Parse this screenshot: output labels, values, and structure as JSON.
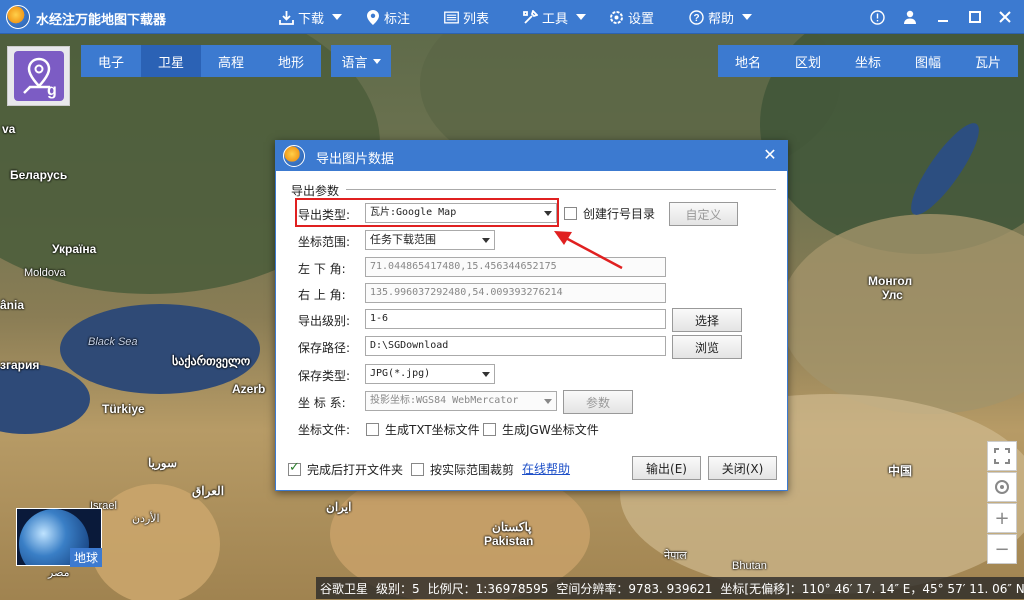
{
  "app": {
    "title": "水经注万能地图下载器"
  },
  "menu": {
    "download": "下载",
    "mark": "标注",
    "list": "列表",
    "tools": "工具",
    "settings": "设置",
    "help": "帮助"
  },
  "toolbar_left": {
    "electronic": "电子",
    "satellite": "卫星",
    "elevation": "高程",
    "terrain": "地形",
    "language": "语言"
  },
  "toolbar_right": {
    "placename": "地名",
    "district": "区划",
    "coordinate": "坐标",
    "sheet": "图幅",
    "tile": "瓦片"
  },
  "map_labels": {
    "belarus": "Беларусь",
    "ukraine": "Україна",
    "moldova": "Moldova",
    "romania": "ânia",
    "black_sea": "Black Sea",
    "georgia": "საქართველო",
    "bulgaria": "згария",
    "azerb": "Azerb",
    "turkiye": "Türkiye",
    "syria": "سوريا",
    "iraq": "العراق",
    "iran": "ایران",
    "israel": "Israel",
    "jordan": "الأردن",
    "egypt": "مصر",
    "pakistan_ur": "پاکستان",
    "pakistan": "Pakistan",
    "nepal": "नेपाल",
    "bhutan": "Bhutan",
    "mongolia1": "Монгол",
    "mongolia2": "Улс",
    "china": "中国",
    "va": "va"
  },
  "dialog": {
    "title": "导出图片数据",
    "close": "✕",
    "group": "导出参数",
    "export_type_label": "导出类型:",
    "export_type_value": "瓦片:Google Map",
    "create_dir_label": "创建行号目录",
    "custom_btn": "自定义",
    "coord_range_label": "坐标范围:",
    "coord_range_value": "任务下载范围",
    "lower_left_label": "左 下 角:",
    "lower_left_value": "71.044865417480,15.456344652175",
    "upper_right_label": "右 上 角:",
    "upper_right_value": "135.996037292480,54.009393276214",
    "level_label": "导出级别:",
    "level_value": "1-6",
    "select_btn": "选择",
    "save_path_label": "保存路径:",
    "save_path_value": "D:\\SGDownload",
    "browse_btn": "浏览",
    "save_type_label": "保存类型:",
    "save_type_value": "JPG(*.jpg)",
    "crs_label": "坐 标 系:",
    "crs_value": "投影坐标:WGS84 WebMercator",
    "params_btn": "参数",
    "coord_file_label": "坐标文件:",
    "txt_label": "生成TXT坐标文件",
    "jgw_label": "生成JGW坐标文件",
    "open_after_label": "完成后打开文件夹",
    "open_after_checked": true,
    "crop_label": "按实际范围裁剪",
    "help_link": "在线帮助",
    "export_btn": "输出(E)",
    "close_btn": "关闭(X)"
  },
  "globe": {
    "label": "地球"
  },
  "status": {
    "source": "谷歌卫星",
    "level": "级别：5",
    "scale": "比例尺：1:36978595",
    "resolution": "空间分辨率：9783. 939621",
    "coord": "坐标[无偏移]：110° 46′ 17. 14″ E，45° 57′ 11. 06″ N"
  },
  "colors": {
    "accent": "#3c7ad0",
    "highlight": "#e02020"
  }
}
